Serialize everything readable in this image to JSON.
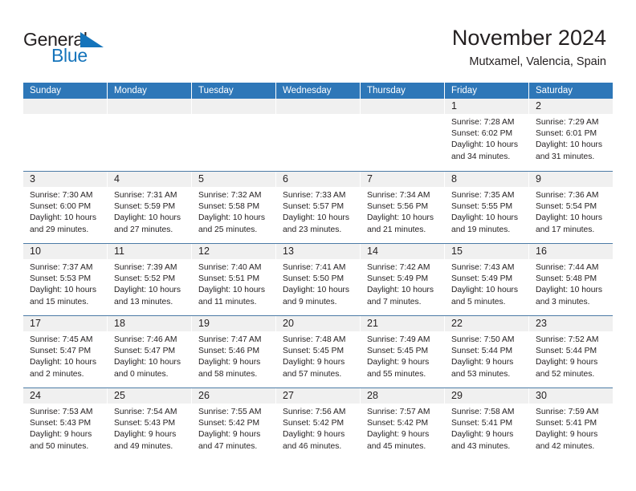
{
  "brand": {
    "word_one": "General",
    "word_two": "Blue",
    "accent_color": "#1574bb",
    "text_color": "#231f20"
  },
  "header": {
    "title": "November 2024",
    "subtitle": "Mutxamel, Valencia, Spain"
  },
  "theme": {
    "header_blue": "#2e77b8",
    "day_band_gray": "#f0f0f0",
    "row_divider": "#4c7ba6"
  },
  "weekdays": [
    "Sunday",
    "Monday",
    "Tuesday",
    "Wednesday",
    "Thursday",
    "Friday",
    "Saturday"
  ],
  "weeks": [
    [
      {
        "date": "",
        "sunrise": "",
        "sunset": "",
        "daylight_line1": "",
        "daylight_line2": ""
      },
      {
        "date": "",
        "sunrise": "",
        "sunset": "",
        "daylight_line1": "",
        "daylight_line2": ""
      },
      {
        "date": "",
        "sunrise": "",
        "sunset": "",
        "daylight_line1": "",
        "daylight_line2": ""
      },
      {
        "date": "",
        "sunrise": "",
        "sunset": "",
        "daylight_line1": "",
        "daylight_line2": ""
      },
      {
        "date": "",
        "sunrise": "",
        "sunset": "",
        "daylight_line1": "",
        "daylight_line2": ""
      },
      {
        "date": "1",
        "sunrise": "Sunrise: 7:28 AM",
        "sunset": "Sunset: 6:02 PM",
        "daylight_line1": "Daylight: 10 hours",
        "daylight_line2": "and 34 minutes."
      },
      {
        "date": "2",
        "sunrise": "Sunrise: 7:29 AM",
        "sunset": "Sunset: 6:01 PM",
        "daylight_line1": "Daylight: 10 hours",
        "daylight_line2": "and 31 minutes."
      }
    ],
    [
      {
        "date": "3",
        "sunrise": "Sunrise: 7:30 AM",
        "sunset": "Sunset: 6:00 PM",
        "daylight_line1": "Daylight: 10 hours",
        "daylight_line2": "and 29 minutes."
      },
      {
        "date": "4",
        "sunrise": "Sunrise: 7:31 AM",
        "sunset": "Sunset: 5:59 PM",
        "daylight_line1": "Daylight: 10 hours",
        "daylight_line2": "and 27 minutes."
      },
      {
        "date": "5",
        "sunrise": "Sunrise: 7:32 AM",
        "sunset": "Sunset: 5:58 PM",
        "daylight_line1": "Daylight: 10 hours",
        "daylight_line2": "and 25 minutes."
      },
      {
        "date": "6",
        "sunrise": "Sunrise: 7:33 AM",
        "sunset": "Sunset: 5:57 PM",
        "daylight_line1": "Daylight: 10 hours",
        "daylight_line2": "and 23 minutes."
      },
      {
        "date": "7",
        "sunrise": "Sunrise: 7:34 AM",
        "sunset": "Sunset: 5:56 PM",
        "daylight_line1": "Daylight: 10 hours",
        "daylight_line2": "and 21 minutes."
      },
      {
        "date": "8",
        "sunrise": "Sunrise: 7:35 AM",
        "sunset": "Sunset: 5:55 PM",
        "daylight_line1": "Daylight: 10 hours",
        "daylight_line2": "and 19 minutes."
      },
      {
        "date": "9",
        "sunrise": "Sunrise: 7:36 AM",
        "sunset": "Sunset: 5:54 PM",
        "daylight_line1": "Daylight: 10 hours",
        "daylight_line2": "and 17 minutes."
      }
    ],
    [
      {
        "date": "10",
        "sunrise": "Sunrise: 7:37 AM",
        "sunset": "Sunset: 5:53 PM",
        "daylight_line1": "Daylight: 10 hours",
        "daylight_line2": "and 15 minutes."
      },
      {
        "date": "11",
        "sunrise": "Sunrise: 7:39 AM",
        "sunset": "Sunset: 5:52 PM",
        "daylight_line1": "Daylight: 10 hours",
        "daylight_line2": "and 13 minutes."
      },
      {
        "date": "12",
        "sunrise": "Sunrise: 7:40 AM",
        "sunset": "Sunset: 5:51 PM",
        "daylight_line1": "Daylight: 10 hours",
        "daylight_line2": "and 11 minutes."
      },
      {
        "date": "13",
        "sunrise": "Sunrise: 7:41 AM",
        "sunset": "Sunset: 5:50 PM",
        "daylight_line1": "Daylight: 10 hours",
        "daylight_line2": "and 9 minutes."
      },
      {
        "date": "14",
        "sunrise": "Sunrise: 7:42 AM",
        "sunset": "Sunset: 5:49 PM",
        "daylight_line1": "Daylight: 10 hours",
        "daylight_line2": "and 7 minutes."
      },
      {
        "date": "15",
        "sunrise": "Sunrise: 7:43 AM",
        "sunset": "Sunset: 5:49 PM",
        "daylight_line1": "Daylight: 10 hours",
        "daylight_line2": "and 5 minutes."
      },
      {
        "date": "16",
        "sunrise": "Sunrise: 7:44 AM",
        "sunset": "Sunset: 5:48 PM",
        "daylight_line1": "Daylight: 10 hours",
        "daylight_line2": "and 3 minutes."
      }
    ],
    [
      {
        "date": "17",
        "sunrise": "Sunrise: 7:45 AM",
        "sunset": "Sunset: 5:47 PM",
        "daylight_line1": "Daylight: 10 hours",
        "daylight_line2": "and 2 minutes."
      },
      {
        "date": "18",
        "sunrise": "Sunrise: 7:46 AM",
        "sunset": "Sunset: 5:47 PM",
        "daylight_line1": "Daylight: 10 hours",
        "daylight_line2": "and 0 minutes."
      },
      {
        "date": "19",
        "sunrise": "Sunrise: 7:47 AM",
        "sunset": "Sunset: 5:46 PM",
        "daylight_line1": "Daylight: 9 hours",
        "daylight_line2": "and 58 minutes."
      },
      {
        "date": "20",
        "sunrise": "Sunrise: 7:48 AM",
        "sunset": "Sunset: 5:45 PM",
        "daylight_line1": "Daylight: 9 hours",
        "daylight_line2": "and 57 minutes."
      },
      {
        "date": "21",
        "sunrise": "Sunrise: 7:49 AM",
        "sunset": "Sunset: 5:45 PM",
        "daylight_line1": "Daylight: 9 hours",
        "daylight_line2": "and 55 minutes."
      },
      {
        "date": "22",
        "sunrise": "Sunrise: 7:50 AM",
        "sunset": "Sunset: 5:44 PM",
        "daylight_line1": "Daylight: 9 hours",
        "daylight_line2": "and 53 minutes."
      },
      {
        "date": "23",
        "sunrise": "Sunrise: 7:52 AM",
        "sunset": "Sunset: 5:44 PM",
        "daylight_line1": "Daylight: 9 hours",
        "daylight_line2": "and 52 minutes."
      }
    ],
    [
      {
        "date": "24",
        "sunrise": "Sunrise: 7:53 AM",
        "sunset": "Sunset: 5:43 PM",
        "daylight_line1": "Daylight: 9 hours",
        "daylight_line2": "and 50 minutes."
      },
      {
        "date": "25",
        "sunrise": "Sunrise: 7:54 AM",
        "sunset": "Sunset: 5:43 PM",
        "daylight_line1": "Daylight: 9 hours",
        "daylight_line2": "and 49 minutes."
      },
      {
        "date": "26",
        "sunrise": "Sunrise: 7:55 AM",
        "sunset": "Sunset: 5:42 PM",
        "daylight_line1": "Daylight: 9 hours",
        "daylight_line2": "and 47 minutes."
      },
      {
        "date": "27",
        "sunrise": "Sunrise: 7:56 AM",
        "sunset": "Sunset: 5:42 PM",
        "daylight_line1": "Daylight: 9 hours",
        "daylight_line2": "and 46 minutes."
      },
      {
        "date": "28",
        "sunrise": "Sunrise: 7:57 AM",
        "sunset": "Sunset: 5:42 PM",
        "daylight_line1": "Daylight: 9 hours",
        "daylight_line2": "and 45 minutes."
      },
      {
        "date": "29",
        "sunrise": "Sunrise: 7:58 AM",
        "sunset": "Sunset: 5:41 PM",
        "daylight_line1": "Daylight: 9 hours",
        "daylight_line2": "and 43 minutes."
      },
      {
        "date": "30",
        "sunrise": "Sunrise: 7:59 AM",
        "sunset": "Sunset: 5:41 PM",
        "daylight_line1": "Daylight: 9 hours",
        "daylight_line2": "and 42 minutes."
      }
    ]
  ]
}
